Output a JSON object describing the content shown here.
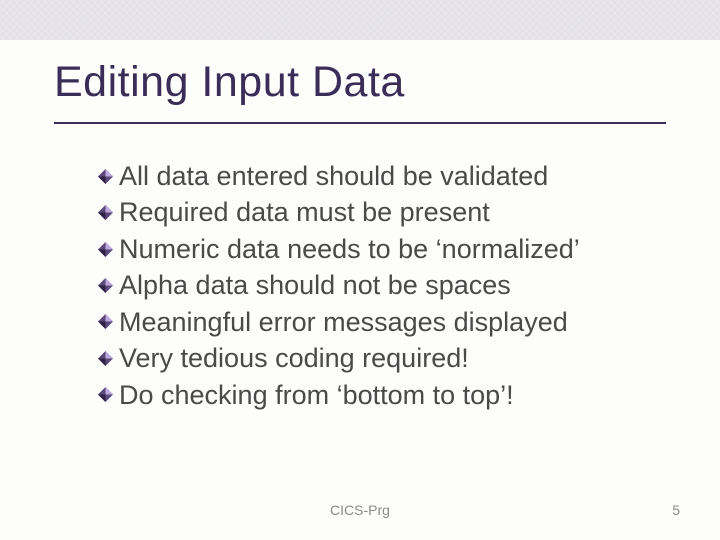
{
  "title": "Editing Input Data",
  "bullets": [
    "All data entered should be validated",
    "Required data must be present",
    "Numeric data needs to be ‘normalized’",
    "Alpha data should not be spaces",
    "Meaningful error messages displayed",
    "Very tedious coding required!",
    "Do checking from ‘bottom to top’!"
  ],
  "footer": {
    "center": "CICS-Prg",
    "page": "5"
  }
}
